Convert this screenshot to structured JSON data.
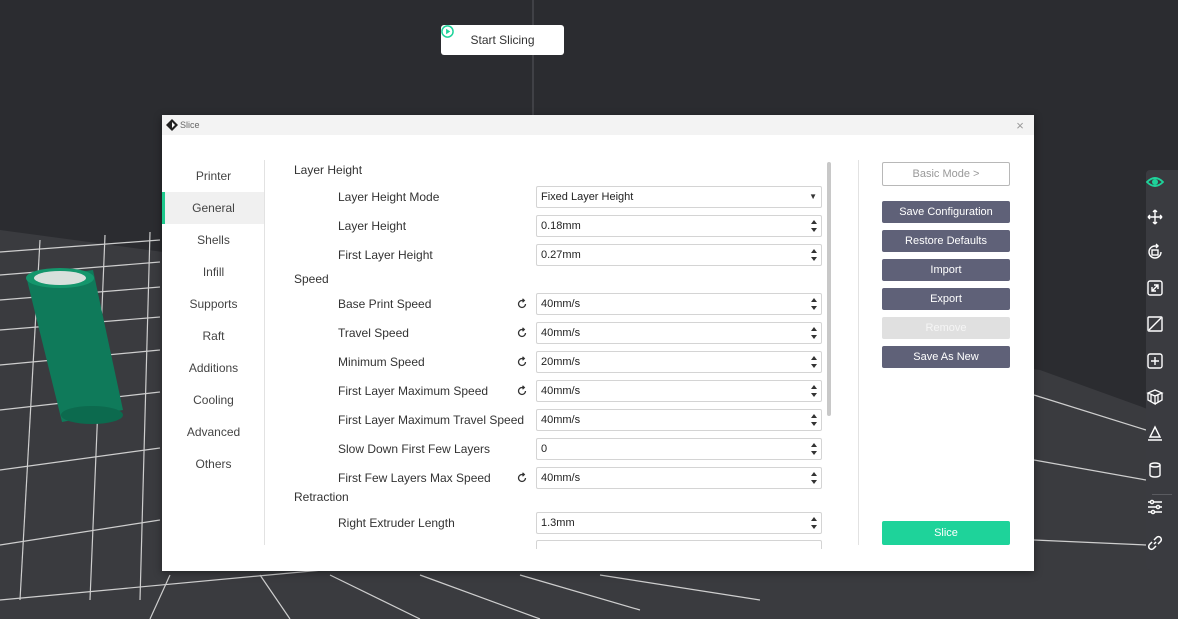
{
  "toolbar": {
    "start_slicing_label": "Start Slicing"
  },
  "dialog": {
    "title": "Slice",
    "close_glyph": "×"
  },
  "nav": {
    "items": [
      "Printer",
      "General",
      "Shells",
      "Infill",
      "Supports",
      "Raft",
      "Additions",
      "Cooling",
      "Advanced",
      "Others"
    ],
    "active": "General"
  },
  "sections": {
    "layer_height": {
      "title": "Layer Height",
      "rows": [
        {
          "label": "Layer Height Mode",
          "value": "Fixed Layer Height",
          "control": "select",
          "reset": false
        },
        {
          "label": "Layer Height",
          "value": "0.18mm",
          "control": "spin",
          "reset": false
        },
        {
          "label": "First Layer Height",
          "value": "0.27mm",
          "control": "spin",
          "reset": false
        }
      ]
    },
    "speed": {
      "title": "Speed",
      "rows": [
        {
          "label": "Base Print Speed",
          "value": "40mm/s",
          "control": "spin",
          "reset": true
        },
        {
          "label": "Travel Speed",
          "value": "40mm/s",
          "control": "spin",
          "reset": true
        },
        {
          "label": "Minimum Speed",
          "value": "20mm/s",
          "control": "spin",
          "reset": true
        },
        {
          "label": "First Layer Maximum Speed",
          "value": "40mm/s",
          "control": "spin",
          "reset": true
        },
        {
          "label": "First Layer Maximum Travel Speed",
          "value": "40mm/s",
          "control": "spin",
          "reset": false
        },
        {
          "label": "Slow Down First Few Layers",
          "value": "0",
          "control": "spin",
          "reset": false
        },
        {
          "label": "First Few Layers Max Speed",
          "value": "40mm/s",
          "control": "spin",
          "reset": true
        }
      ]
    },
    "retraction": {
      "title": "Retraction",
      "rows": [
        {
          "label": "Right Extruder Length",
          "value": "1.3mm",
          "control": "spin",
          "reset": false
        }
      ]
    }
  },
  "actions": {
    "basic_mode": "Basic Mode >",
    "save_configuration": "Save Configuration",
    "restore_defaults": "Restore Defaults",
    "import": "Import",
    "export": "Export",
    "remove": "Remove",
    "save_as_new": "Save As New",
    "slice": "Slice"
  },
  "right_toolbar": {
    "icons": [
      "eye-icon",
      "move-icon",
      "rotate-icon",
      "scale-icon",
      "mirror-icon",
      "add-icon",
      "support-icon",
      "lay-flat-icon",
      "cylinder-icon",
      "settings-sliders-icon",
      "link-icon"
    ],
    "active_color": "#1ed39a"
  },
  "colors": {
    "accent": "#1ed39a",
    "button": "#5f6178",
    "model": "#0f7a5a"
  }
}
